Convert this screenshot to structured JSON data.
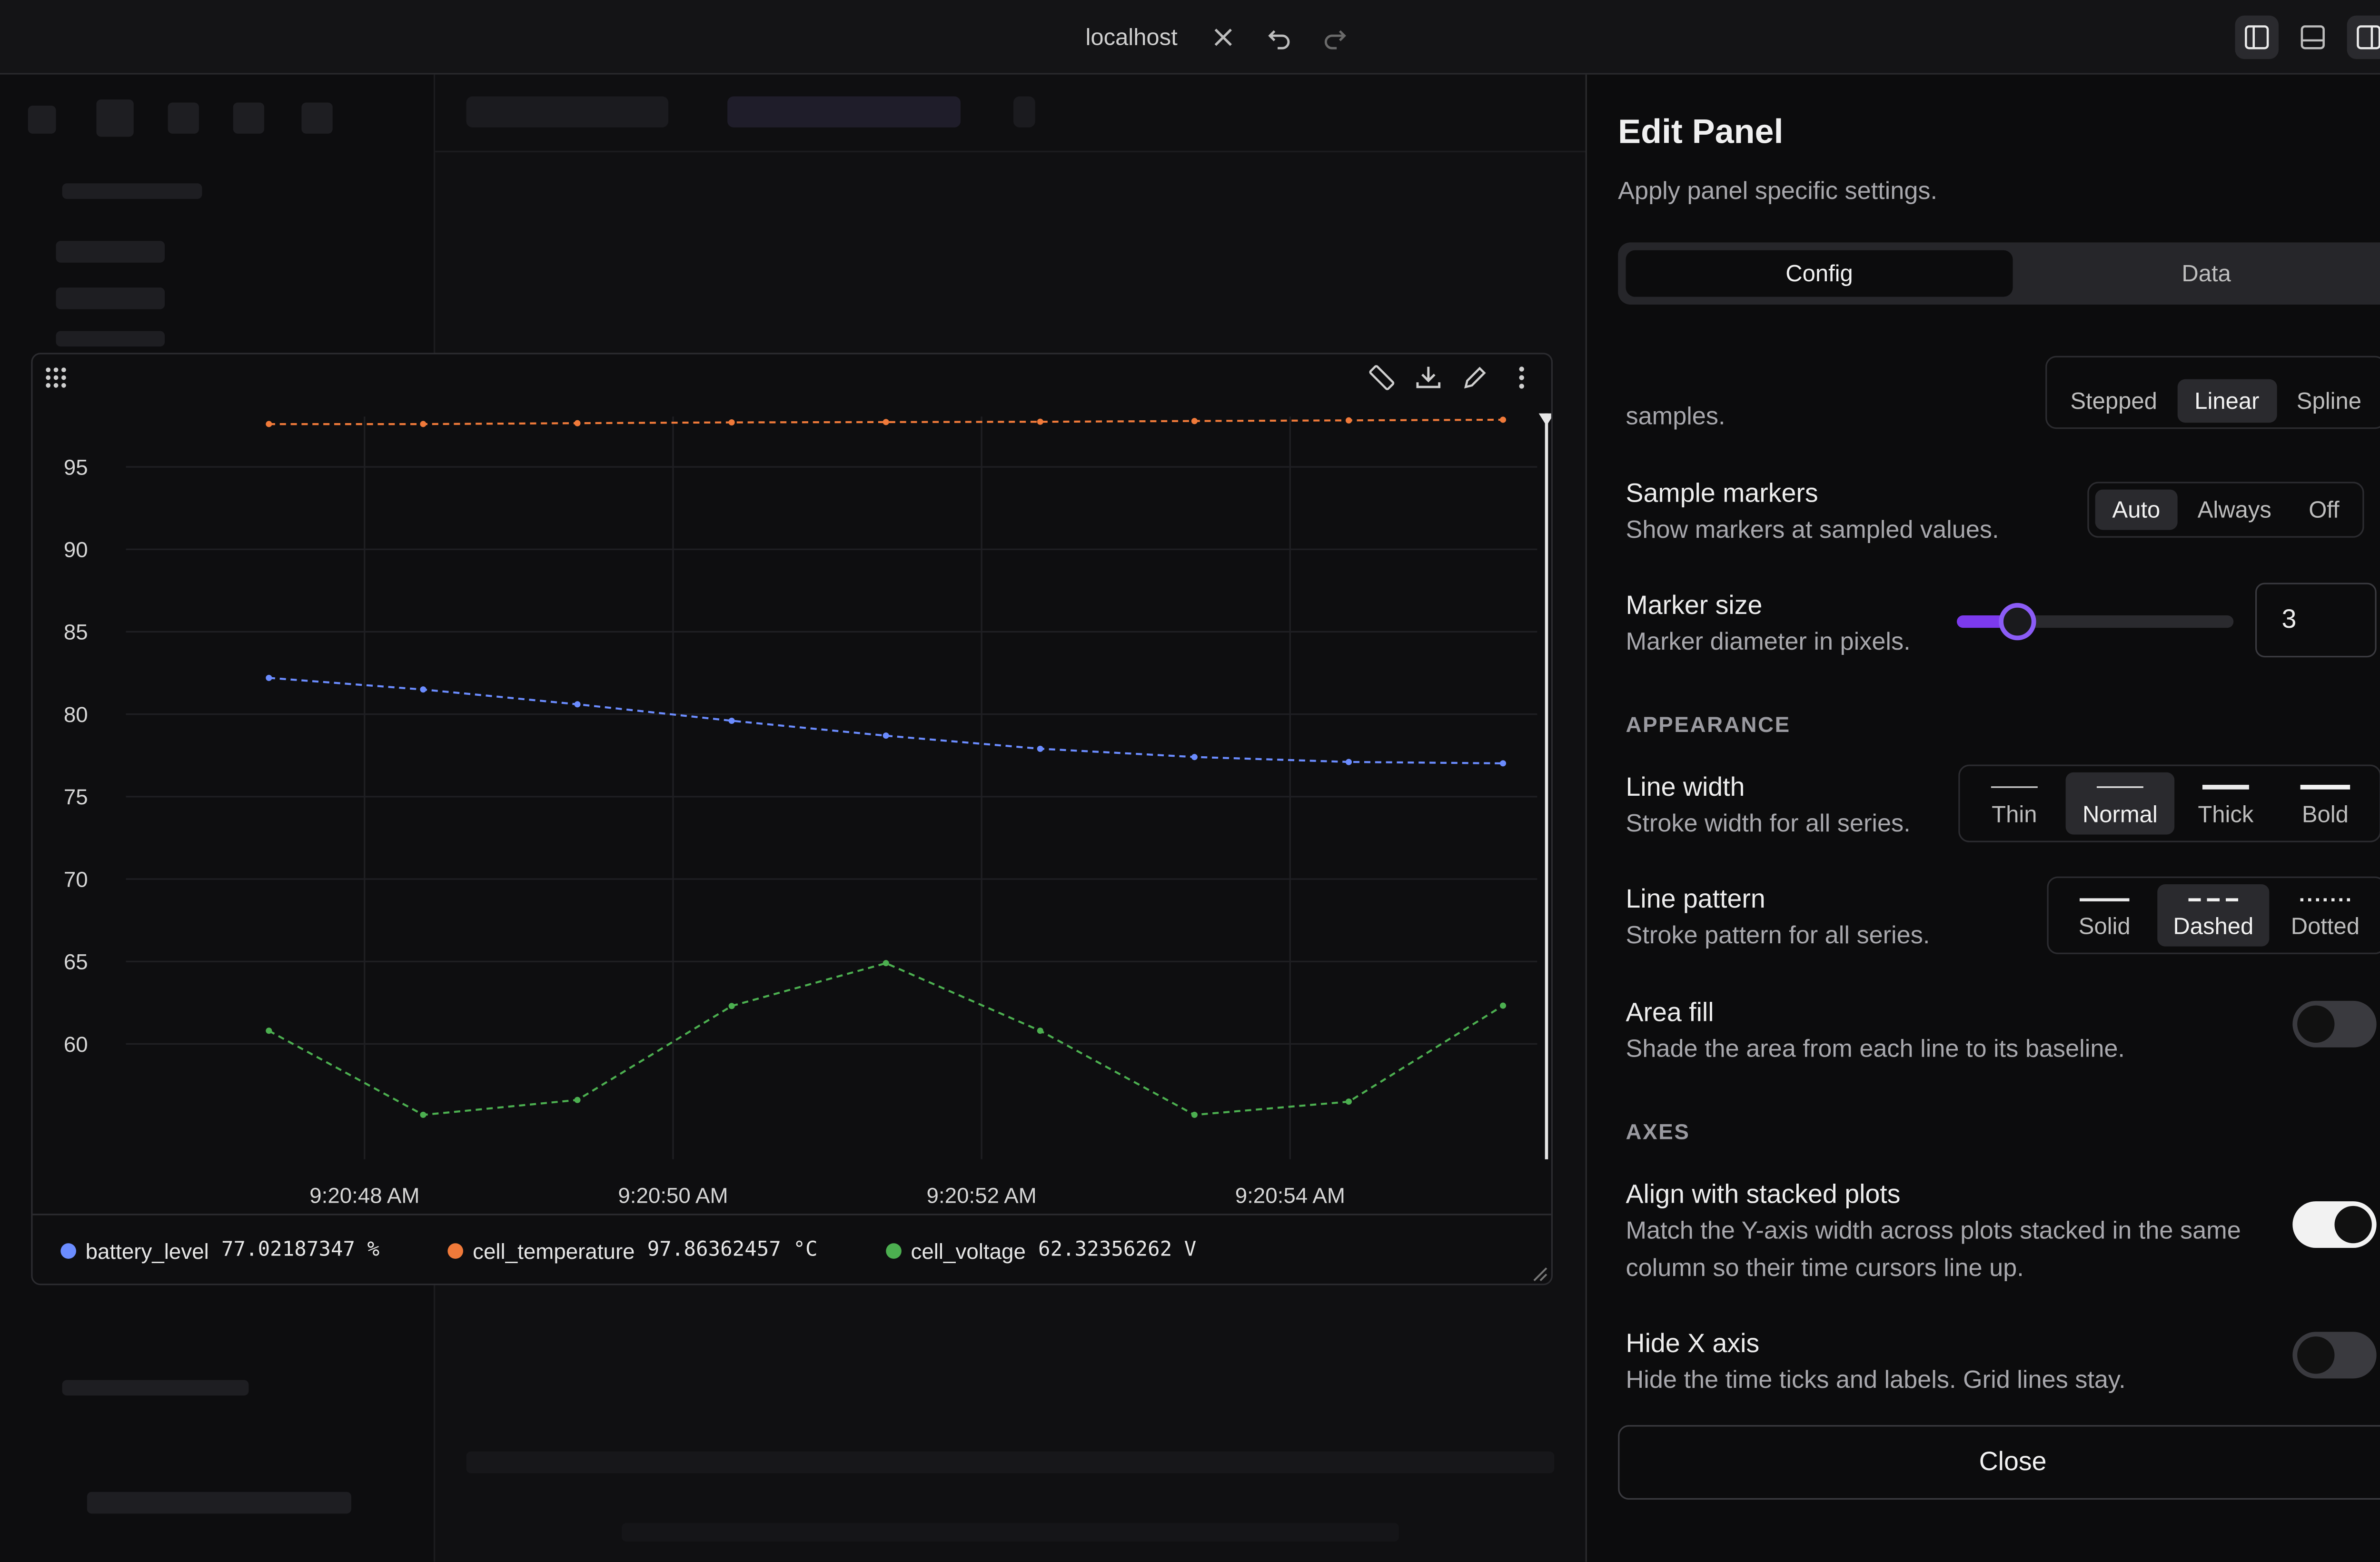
{
  "titlebar": {
    "url": "localhost",
    "icons": [
      "close-icon",
      "undo-icon",
      "redo-icon",
      "layout-left-sidebar-icon",
      "layout-bottom-panel-icon",
      "layout-right-sidebar-icon"
    ]
  },
  "plot": {
    "toolbar_icons": [
      "ruler-icon",
      "download-icon",
      "pencil-icon",
      "more-vertical-icon"
    ],
    "legend": [
      {
        "name": "battery_level",
        "value": "77.02187347 %",
        "color": "#6b8cff"
      },
      {
        "name": "cell_temperature",
        "value": "97.86362457 °C",
        "color": "#f07a3a"
      },
      {
        "name": "cell_voltage",
        "value": "62.32356262 V",
        "color": "#4caf50"
      }
    ]
  },
  "chart_data": {
    "type": "line",
    "x_ticks": [
      "9:20:48 AM",
      "9:20:50 AM",
      "9:20:52 AM",
      "9:20:54 AM"
    ],
    "x": [
      0,
      1,
      2,
      3,
      4,
      5,
      6,
      7,
      8
    ],
    "y_ticks": [
      95,
      90,
      85,
      80,
      75,
      70,
      65,
      60
    ],
    "ylim": [
      53,
      99
    ],
    "line_pattern": "dashed",
    "series": [
      {
        "name": "cell_temperature",
        "color": "#f07a3a",
        "values": [
          97.6,
          97.6,
          97.65,
          97.7,
          97.72,
          97.74,
          97.78,
          97.82,
          97.86
        ]
      },
      {
        "name": "battery_level",
        "color": "#6b8cff",
        "values": [
          82.2,
          81.5,
          80.6,
          79.6,
          78.7,
          77.9,
          77.4,
          77.1,
          77.02
        ]
      },
      {
        "name": "cell_voltage",
        "color": "#4caf50",
        "values": [
          60.8,
          55.7,
          56.6,
          62.3,
          64.9,
          60.8,
          55.7,
          56.5,
          62.32
        ]
      }
    ]
  },
  "edit_panel": {
    "title": "Edit Panel",
    "subtitle": "Apply panel specific settings.",
    "tabs": {
      "config": "Config",
      "data": "Data"
    },
    "interp": {
      "desc_tail": "samples.",
      "options": [
        "Stepped",
        "Linear",
        "Spline"
      ],
      "selected": "Linear"
    },
    "sample_markers": {
      "title": "Sample markers",
      "desc": "Show markers at sampled values.",
      "options": [
        "Auto",
        "Always",
        "Off"
      ],
      "selected": "Auto"
    },
    "marker_size": {
      "title": "Marker size",
      "desc": "Marker diameter in pixels.",
      "value": "3",
      "fraction": 0.22
    },
    "appearance": "APPEARANCE",
    "line_width": {
      "title": "Line width",
      "desc": "Stroke width for all series.",
      "options": [
        "Thin",
        "Normal",
        "Thick",
        "Bold"
      ],
      "selected": "Normal"
    },
    "line_pattern": {
      "title": "Line pattern",
      "desc": "Stroke pattern for all series.",
      "options": [
        "Solid",
        "Dashed",
        "Dotted"
      ],
      "selected": "Dashed"
    },
    "area_fill": {
      "title": "Area fill",
      "desc": "Shade the area from each line to its baseline.",
      "on": false
    },
    "axes": "AXES",
    "align": {
      "title": "Align with stacked plots",
      "desc": "Match the Y-axis width across plots stacked in the same column so their time cursors line up.",
      "on": true
    },
    "hide_x": {
      "title": "Hide X axis",
      "desc": "Hide the time ticks and labels. Grid lines stay.",
      "on": false
    },
    "close_label": "Close"
  }
}
